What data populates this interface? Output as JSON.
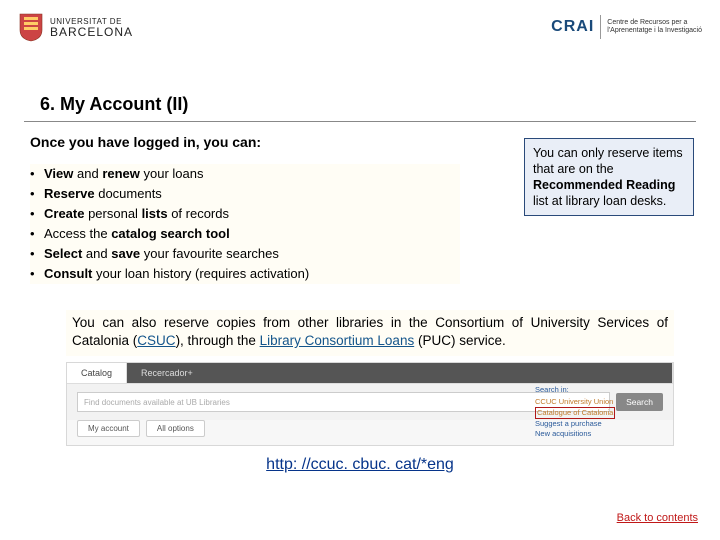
{
  "header": {
    "ub_top": "UNIVERSITAT DE",
    "ub_bottom": "BARCELONA",
    "crai": "CRAI",
    "crai_desc1": "Centre de Recursos per a",
    "crai_desc2": "l'Aprenentatge i la Investigació"
  },
  "title": "6. My Account (II)",
  "intro": "Once you have logged in, you can:",
  "bullets": [
    {
      "pre": "",
      "b1": "View",
      "mid1": " and ",
      "b2": "renew",
      "post": " your loans"
    },
    {
      "pre": "",
      "b1": "Reserve",
      "post": " documents"
    },
    {
      "pre": "",
      "b1": "Create",
      "mid1": " personal ",
      "b2": "lists",
      "post": " of records"
    },
    {
      "pre": "Access the ",
      "b1": "catalog search tool",
      "post": ""
    },
    {
      "pre": "",
      "b1": "Select",
      "mid1": " and ",
      "b2": "save",
      "post": " your favourite searches"
    },
    {
      "pre": "",
      "b1": "Consult",
      "post": " your loan history (requires activation)"
    }
  ],
  "note": {
    "t1": "You can only reserve items that are on the ",
    "b1": "Recommended Reading",
    "t2": " list at library loan desks."
  },
  "para": {
    "t1": "You can also reserve copies from other libraries in the Consortium of University Services of Catalonia (",
    "link1": "CSUC",
    "t2": "), through the ",
    "link2": "Library Consortium Loans",
    "t3": " (PUC) service."
  },
  "catalog": {
    "tab_active": "Catalog",
    "tab_inactive": "Recercador+",
    "search_placeholder": "Find documents available at UB Libraries",
    "search_btn": "Search",
    "right_hdr": "Search in:",
    "right_items": [
      "CCUC University Union",
      "Catalogue of Catalonia",
      "Suggest a purchase",
      "New acquisitions"
    ],
    "btn1": "My account",
    "btn2": "All options"
  },
  "ccuc_url": "http: //ccuc. cbuc. cat/*eng",
  "back": "Back to contents"
}
